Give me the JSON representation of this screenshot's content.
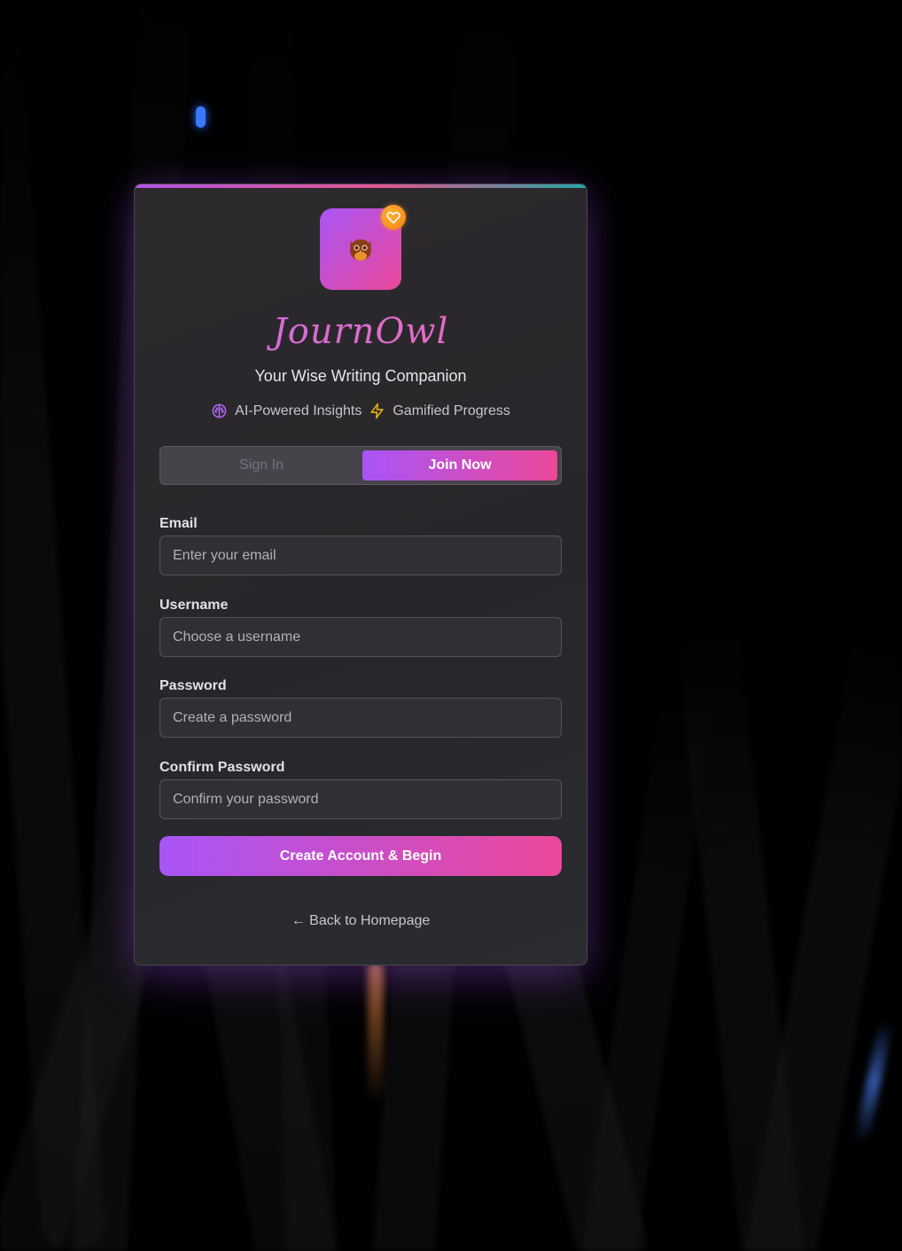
{
  "brand": {
    "name": "JournOwl",
    "tagline": "Your Wise Writing Companion",
    "gradient_start": "#a855f7",
    "gradient_end": "#ec4899",
    "logo_icon": "owl-icon",
    "badge_icon": "heart-icon"
  },
  "features": [
    {
      "icon": "brain-icon",
      "label": "AI-Powered Insights",
      "color": "#a855f7"
    },
    {
      "icon": "lightning-icon",
      "label": "Gamified Progress",
      "color": "#eab308"
    }
  ],
  "tabs": {
    "signin_label": "Sign In",
    "join_label": "Join Now",
    "active": "join"
  },
  "form": {
    "email": {
      "label": "Email",
      "placeholder": "Enter your email",
      "value": ""
    },
    "username": {
      "label": "Username",
      "placeholder": "Choose a username",
      "value": ""
    },
    "password": {
      "label": "Password",
      "placeholder": "Create a password",
      "value": ""
    },
    "confirm_password": {
      "label": "Confirm Password",
      "placeholder": "Confirm your password",
      "value": ""
    },
    "submit_label": "Create Account & Begin"
  },
  "back_link": {
    "label": "← Back to Homepage"
  }
}
